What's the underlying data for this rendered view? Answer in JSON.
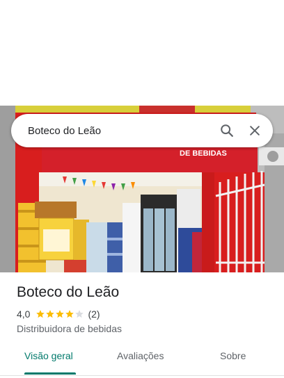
{
  "search": {
    "value": "Boteco do Leão"
  },
  "place": {
    "name": "Boteco do Leão",
    "rating": "4,0",
    "rating_value": 4.0,
    "review_count": "(2)",
    "category": "Distribuidora de bebidas",
    "sign_text": "DE BEBIDAS"
  },
  "tabs": [
    {
      "label": "Visão geral",
      "active": true
    },
    {
      "label": "Avaliações",
      "active": false
    },
    {
      "label": "Sobre",
      "active": false
    }
  ],
  "colors": {
    "accent": "#00796b",
    "star": "#fbbc04",
    "star_empty": "#dadce0",
    "storefront": "#d81e1e"
  },
  "icons": [
    "search-icon",
    "close-icon",
    "star-icon"
  ]
}
